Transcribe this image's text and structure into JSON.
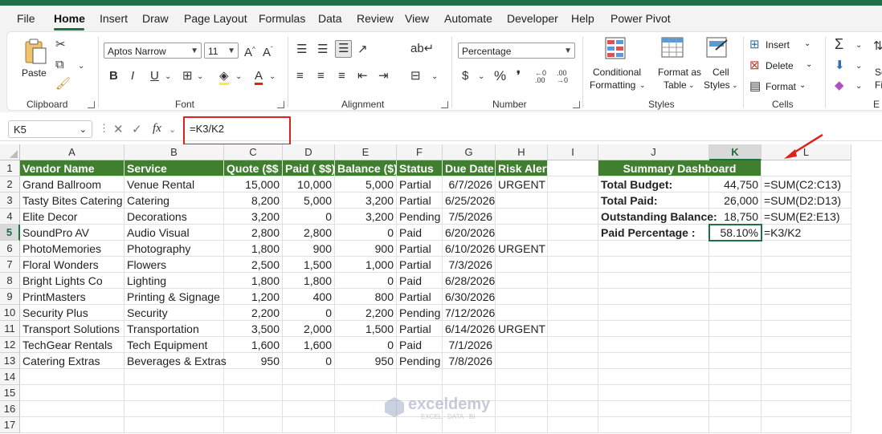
{
  "menu": [
    "File",
    "Home",
    "Insert",
    "Draw",
    "Page Layout",
    "Formulas",
    "Data",
    "Review",
    "View",
    "Automate",
    "Developer",
    "Help",
    "Power Pivot"
  ],
  "ribbon": {
    "paste": "Paste",
    "groups": [
      "Clipboard",
      "Font",
      "Alignment",
      "Number",
      "Styles",
      "Cells",
      "E"
    ],
    "font_name": "Aptos Narrow",
    "font_size": "11",
    "number_format": "Percentage",
    "conditional_1": "Conditional",
    "conditional_2": "Formatting",
    "format_as_1": "Format as",
    "format_as_2": "Table",
    "cell_styles_1": "Cell",
    "cell_styles_2": "Styles",
    "insert": "Insert",
    "delete": "Delete",
    "format": "Format",
    "sort_1": "So",
    "sort_2": "Fi"
  },
  "formula_bar": {
    "name_box": "K5",
    "formula": "=K3/K2"
  },
  "columns": [
    "A",
    "B",
    "C",
    "D",
    "E",
    "F",
    "G",
    "H",
    "I",
    "J",
    "K",
    "L"
  ],
  "rows": [
    "1",
    "2",
    "3",
    "4",
    "5",
    "6",
    "7",
    "8",
    "9",
    "10",
    "11",
    "12",
    "13",
    "14",
    "15",
    "16",
    "17"
  ],
  "table": {
    "headers": [
      "Vendor Name",
      "Service",
      "Quote ($$ )",
      "Paid ( $$)",
      "Balance ($)",
      "Status",
      "Due Date",
      "Risk Alert"
    ],
    "rows": [
      [
        "Grand Ballroom",
        "Venue Rental",
        "15,000",
        "10,000",
        "5,000",
        "Partial",
        "6/7/2026",
        "URGENT"
      ],
      [
        "Tasty Bites Catering",
        "Catering",
        "8,200",
        "5,000",
        "3,200",
        "Partial",
        "6/25/2026",
        ""
      ],
      [
        "Elite Decor",
        "Decorations",
        "3,200",
        "0",
        "3,200",
        "Pending",
        "7/5/2026",
        ""
      ],
      [
        "SoundPro AV",
        "Audio Visual",
        "2,800",
        "2,800",
        "0",
        "Paid",
        "6/20/2026",
        ""
      ],
      [
        "PhotoMemories",
        "Photography",
        "1,800",
        "900",
        "900",
        "Partial",
        "6/10/2026",
        "URGENT"
      ],
      [
        "Floral Wonders",
        "Flowers",
        "2,500",
        "1,500",
        "1,000",
        "Partial",
        "7/3/2026",
        ""
      ],
      [
        "Bright Lights Co",
        "Lighting",
        "1,800",
        "1,800",
        "0",
        "Paid",
        "6/28/2026",
        ""
      ],
      [
        "PrintMasters",
        "Printing & Signage",
        "1,200",
        "400",
        "800",
        "Partial",
        "6/30/2026",
        ""
      ],
      [
        "Security Plus",
        "Security",
        "2,200",
        "0",
        "2,200",
        "Pending",
        "7/12/2026",
        ""
      ],
      [
        "Transport Solutions",
        "Transportation",
        "3,500",
        "2,000",
        "1,500",
        "Partial",
        "6/14/2026",
        "URGENT"
      ],
      [
        "TechGear Rentals",
        "Tech Equipment",
        "1,600",
        "1,600",
        "0",
        "Paid",
        "7/1/2026",
        ""
      ],
      [
        "Catering Extras",
        "Beverages & Extras",
        "950",
        "0",
        "950",
        "Pending",
        "7/8/2026",
        ""
      ]
    ]
  },
  "summary": {
    "title": "Summary Dashboard",
    "items": [
      {
        "label": "Total Budget:",
        "value": "44,750",
        "formula": "=SUM(C2:C13)"
      },
      {
        "label": "Total Paid:",
        "value": "26,000",
        "formula": "=SUM(D2:D13)"
      },
      {
        "label": "Outstanding Balance:",
        "value": "18,750",
        "formula": "=SUM(E2:E13)"
      },
      {
        "label": "Paid Percentage :",
        "value": "58.10%",
        "formula": "=K3/K2"
      }
    ]
  },
  "watermark": {
    "name": "exceldemy",
    "tagline": "EXCEL · DATA · BI"
  },
  "colors": {
    "accent": "#1e7145",
    "header_fill": "#3f7f2f",
    "highlight": "#e0201b"
  }
}
